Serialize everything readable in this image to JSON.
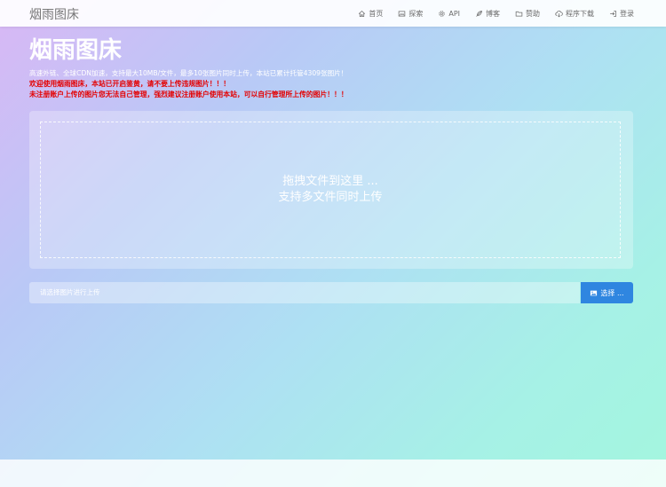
{
  "navbar": {
    "brand": "烟雨图床",
    "items": [
      {
        "label": "首页",
        "icon": "home-icon"
      },
      {
        "label": "探索",
        "icon": "image-icon"
      },
      {
        "label": "API",
        "icon": "gear-icon"
      },
      {
        "label": "博客",
        "icon": "feather-icon"
      },
      {
        "label": "赞助",
        "icon": "folder-icon"
      },
      {
        "label": "程序下载",
        "icon": "cloud-download-icon"
      },
      {
        "label": "登录",
        "icon": "sign-in-icon"
      }
    ]
  },
  "hero": {
    "title": "烟雨图床",
    "description": "高速外链、全球CDN加速，支持最大10MB/文件，最多10张图片同时上传，本站已累计托管4309张图片！",
    "warning_1": "欢迎使用烟雨图床，本站已开启鉴黄，请不要上传违规图片！！！",
    "warning_2": "未注册账户上传的图片您无法自己管理，强烈建议注册账户使用本站，可以自行管理所上传的图片！！！"
  },
  "upload": {
    "drop_line_1": "拖拽文件到这里 ...",
    "drop_line_2": "支持多文件同时上传",
    "input_placeholder": "请选择图片进行上传",
    "choose_label": "选择 ..."
  },
  "colors": {
    "accent": "#2f86e0",
    "warning": "#e40000"
  }
}
